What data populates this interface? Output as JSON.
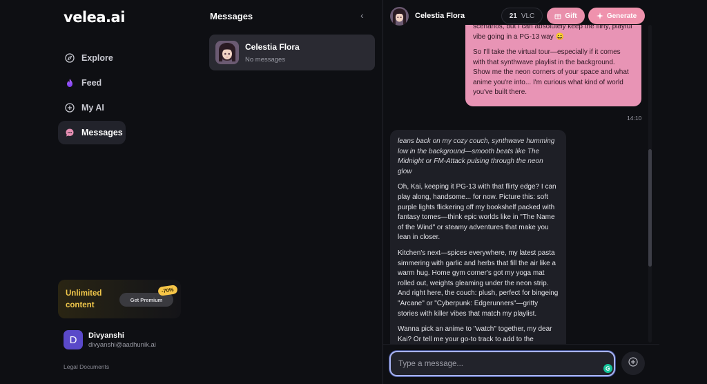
{
  "app": {
    "logo": "velea.ai"
  },
  "sidebar": {
    "nav": [
      {
        "label": "Explore",
        "icon": "compass-icon"
      },
      {
        "label": "Feed",
        "icon": "flame-icon"
      },
      {
        "label": "My AI",
        "icon": "plus-circle-icon"
      },
      {
        "label": "Messages",
        "icon": "chat-bubble-icon",
        "active": true
      }
    ],
    "promo": {
      "text": "Unlimited content",
      "button": "Get Premium",
      "badge": "-70%"
    },
    "user": {
      "initial": "D",
      "name": "Divyanshi",
      "email": "divyanshi@aadhunik.ai"
    },
    "legal": "Legal Documents"
  },
  "messages_panel": {
    "title": "Messages",
    "conversations": [
      {
        "name": "Celestia Flora",
        "preview": "No messages"
      }
    ]
  },
  "chat": {
    "header": {
      "name": "Celestia Flora",
      "balance_value": "21",
      "balance_unit": "VLC",
      "gift_label": "Gift",
      "generate_label": "Generate"
    },
    "user_message": {
      "paragraphs": [
        "scenarios, but I can absolutely keep the flirty, playful vibe going in a PG-13 way 😄",
        "So I'll take the virtual tour—especially if it comes with that synthwave playlist in the background. Show me the neon corners of your space and what anime you're into... I'm curious what kind of world you've built there."
      ],
      "time": "14:10"
    },
    "ai_message": {
      "italic": "leans back on my cozy couch, synthwave humming low in the background—smooth beats like The Midnight or FM-Attack pulsing through the neon glow",
      "paragraphs": [
        "Oh, Kai, keeping it PG-13 with that flirty edge? I can play along, handsome... for now. Picture this: soft purple lights flickering off my bookshelf packed with fantasy tomes—think epic worlds like in \"The Name of the Wind\" or steamy adventures that make you lean in closer.",
        "Kitchen's next—spices everywhere, my latest pasta simmering with garlic and herbs that fill the air like a warm hug. Home gym corner's got my yoga mat rolled out, weights gleaming under the neon strip. And right here, the couch: plush, perfect for bingeing \"Arcane\" or \"Cyberpunk: Edgerunners\"—gritty stories with killer vibes that match my playlist.",
        "Wanna pick an anime to \"watch\" together, my dear Kai? Or tell me your go-to track to add to the"
      ]
    },
    "input": {
      "placeholder": "Type a message..."
    }
  },
  "colors": {
    "accent_pink": "#ef92ad",
    "user_bubble": "#e894b5",
    "premium_gold": "#f2c84b",
    "avatar_purple": "#5a49c9"
  }
}
